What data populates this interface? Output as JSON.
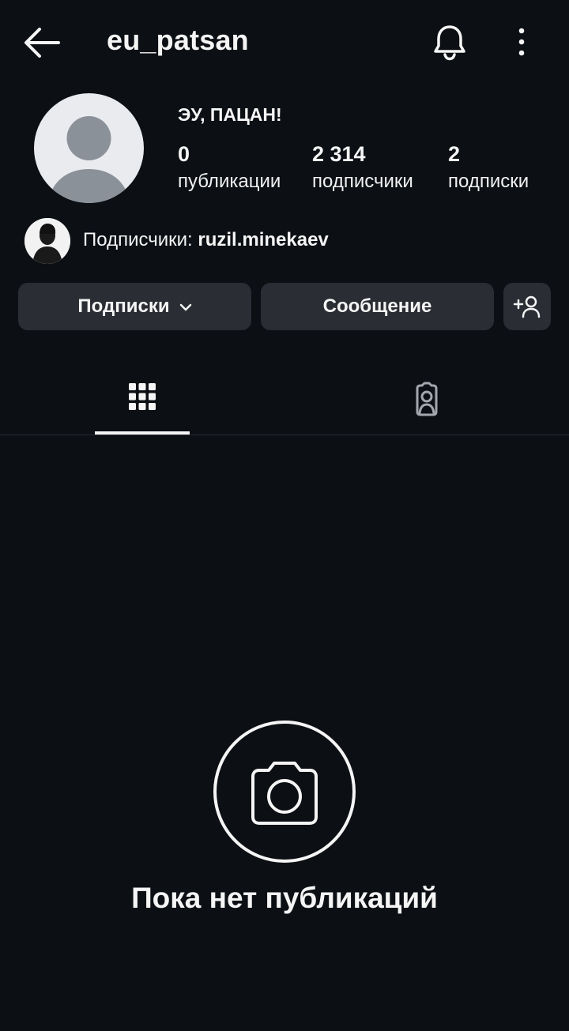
{
  "header": {
    "username": "eu_patsan"
  },
  "profile": {
    "display_name": "ЭУ, ПАЦАН!",
    "stats": {
      "posts": {
        "value": "0",
        "label": "публикации"
      },
      "followers": {
        "value": "2 314",
        "label": "подписчики"
      },
      "following": {
        "value": "2",
        "label": "подписки"
      }
    },
    "mutual": {
      "prefix": "Подписчики: ",
      "name": "ruzil.minekaev"
    }
  },
  "actions": {
    "following_label": "Подписки",
    "message_label": "Сообщение"
  },
  "tabs": [
    {
      "icon": "grid-icon",
      "active": true
    },
    {
      "icon": "tagged-person-icon",
      "active": false
    }
  ],
  "empty_state": {
    "icon": "camera-icon",
    "title": "Пока нет публикаций"
  },
  "colors": {
    "background": "#0c0f14",
    "button": "#2a2d33",
    "text": "#f5f5f5",
    "avatar_placeholder": "#8b9199"
  }
}
